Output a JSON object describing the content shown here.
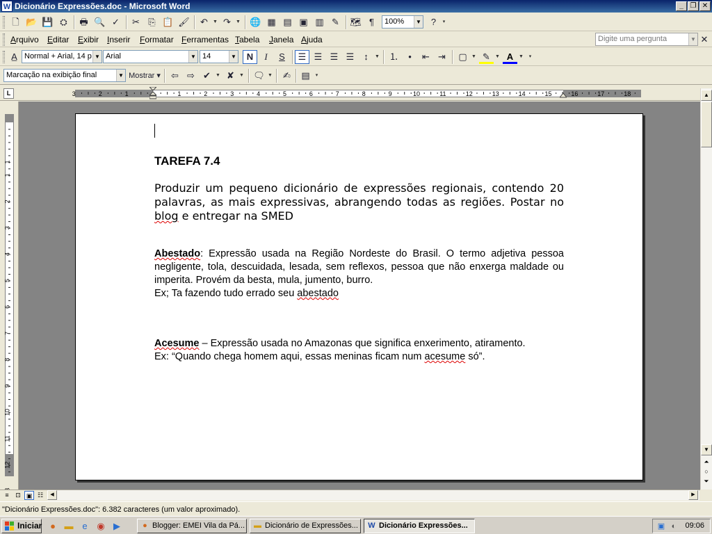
{
  "window": {
    "title": "Dicionário Expressões.doc - Microsoft Word",
    "app_icon_letter": "W"
  },
  "menu": {
    "items": [
      "Arquivo",
      "Editar",
      "Exibir",
      "Inserir",
      "Formatar",
      "Ferramentas",
      "Tabela",
      "Janela",
      "Ajuda"
    ],
    "help_placeholder": "Digite uma pergunta"
  },
  "standard_toolbar": {
    "zoom": "100%"
  },
  "format_toolbar": {
    "style": "Normal + Arial, 14 p",
    "font": "Arial",
    "size": "14",
    "bold_label": "N",
    "italic_label": "I",
    "underline_label": "S"
  },
  "review_toolbar": {
    "display_mode": "Marcação na exibição final",
    "show_label": "Mostrar"
  },
  "ruler": {
    "h_labels": [
      "3",
      "2",
      "1",
      "1",
      "2",
      "3",
      "4",
      "5",
      "6",
      "7",
      "8",
      "9",
      "10",
      "11",
      "12",
      "13",
      "14",
      "15",
      "16",
      "17",
      "18"
    ],
    "v_labels": [
      "1",
      "1",
      "2",
      "3",
      "4",
      "5",
      "6",
      "7",
      "8",
      "9",
      "10",
      "11",
      "12",
      "13"
    ],
    "corner": "L"
  },
  "document": {
    "title": "TAREFA 7.4",
    "intro_before": "Produzir um pequeno dicionário de expressões regionais, contendo 20 palavras, as mais expressivas, abrangendo todas as regiões. Postar no ",
    "intro_word": "blog",
    "intro_after": " e entregar na SMED",
    "entry1": {
      "term": "Abestado",
      "definition": ": Expressão usada na Região Nordeste do Brasil. O termo adjetiva pessoa negligente, tola, descuidada, lesada, sem reflexos, pessoa que não enxerga maldade ou imperita. Provém da besta, mula, jumento, burro.",
      "example_before": "Ex; Ta fazendo tudo errado seu ",
      "example_word": "abestado"
    },
    "entry2": {
      "term": "Acesume",
      "definition": " – Expressão usada no Amazonas que significa enxerimento, atiramento.",
      "example_before": "Ex: “Quando chega homem aqui, essas meninas ficam num ",
      "example_word": "acesume",
      "example_after": " só”."
    }
  },
  "status_bar": {
    "text": "\"Dicionário Expressões.doc\": 6.382 caracteres (um valor aproximado)."
  },
  "taskbar": {
    "start_label": "Iniciar",
    "tasks": [
      {
        "label": "Blogger: EMEI Vila da Pá...",
        "icon": "firefox-icon"
      },
      {
        "label": "Dicionário de Expressões...",
        "icon": "folder-icon"
      },
      {
        "label": "Dicionário Expressões...",
        "icon": "word-icon"
      }
    ],
    "clock": "09:06"
  },
  "colors": {
    "title_bar": "#0a246a",
    "workspace": "#848484",
    "spell_underline": "#dd0000"
  }
}
